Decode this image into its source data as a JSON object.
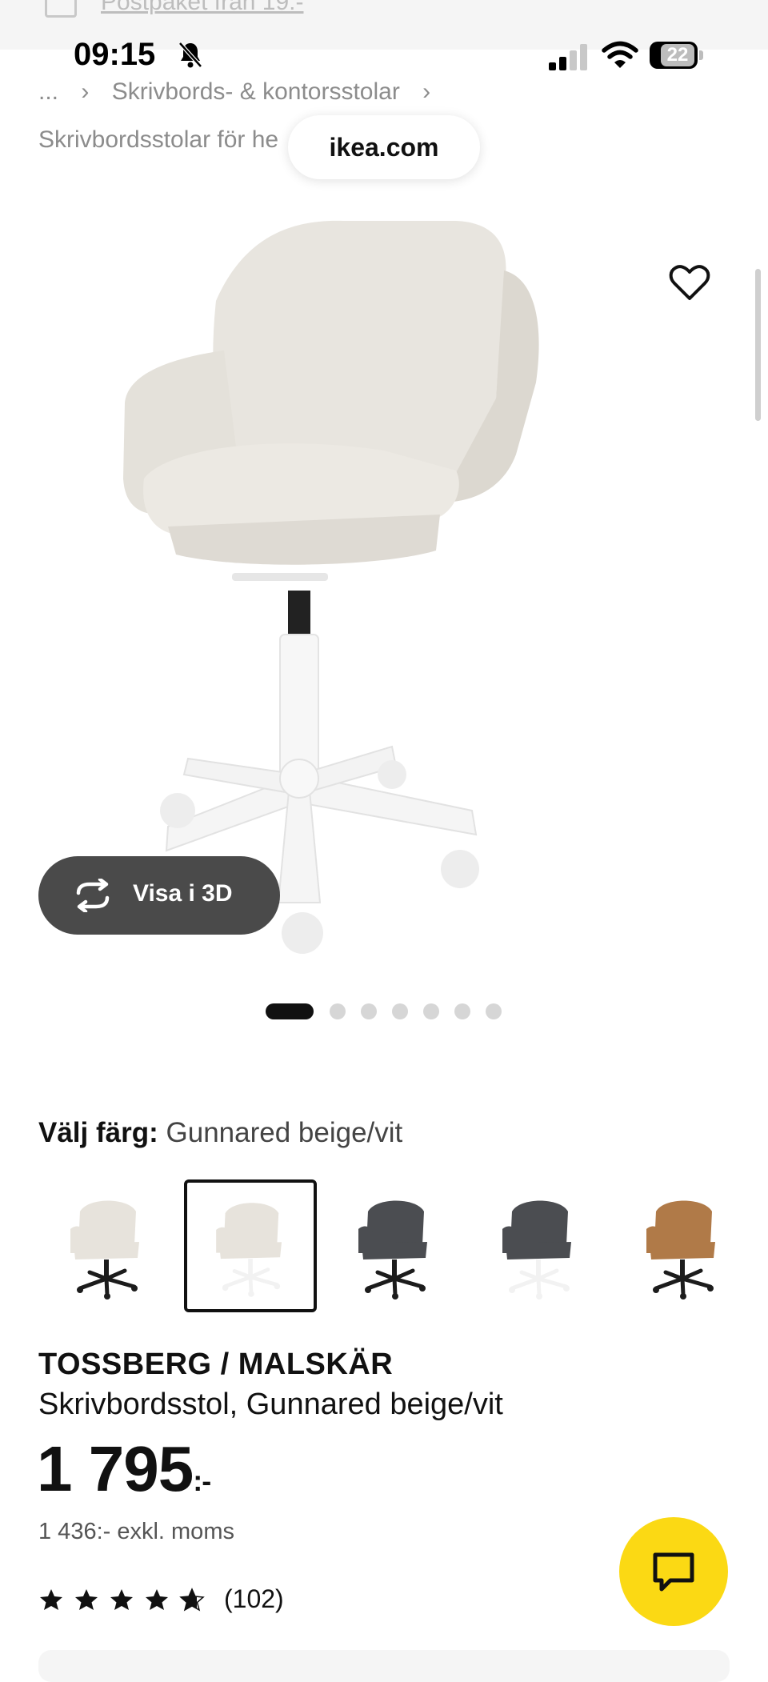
{
  "top_banner": {
    "text": "Postpaket från 19:-",
    "icon": "package-icon"
  },
  "status_bar": {
    "time": "09:15",
    "battery": "22",
    "icons": [
      "bell-slash-icon",
      "signal-icon",
      "wifi-icon",
      "battery-icon"
    ]
  },
  "breadcrumb": {
    "ellipsis": "...",
    "separator": "›",
    "category": "Skrivbords- & kontorsstolar",
    "trailing_separator": "›"
  },
  "subcategory": "Skrivbordsstolar för he",
  "browser": {
    "url": "ikea.com"
  },
  "gallery": {
    "view_3d_label": "Visa i 3D",
    "image_count": 7,
    "active_index": 0,
    "favorite_icon": "heart-icon"
  },
  "color_selector": {
    "label": "Välj färg:",
    "value": "Gunnared beige/vit",
    "selected_index": 1,
    "options": [
      {
        "upholstery": "#e7e3dc",
        "base": "#1c1c1c"
      },
      {
        "upholstery": "#e7e3dc",
        "base": "#f2f2f2"
      },
      {
        "upholstery": "#4b4d51",
        "base": "#1c1c1c"
      },
      {
        "upholstery": "#4b4d51",
        "base": "#f2f2f2"
      },
      {
        "upholstery": "#b07a48",
        "base": "#1c1c1c"
      }
    ]
  },
  "product": {
    "name": "TOSSBERG / MALSKÄR",
    "description": "Skrivbordsstol, Gunnared beige/vit",
    "price": "1 795",
    "price_suffix": ":-",
    "price_excl_vat": "1 436:- exkl. moms",
    "rating": 4.5,
    "rating_max": 5,
    "review_count": "(102)"
  },
  "chat": {
    "icon": "chat-icon",
    "color": "#fbd914"
  }
}
